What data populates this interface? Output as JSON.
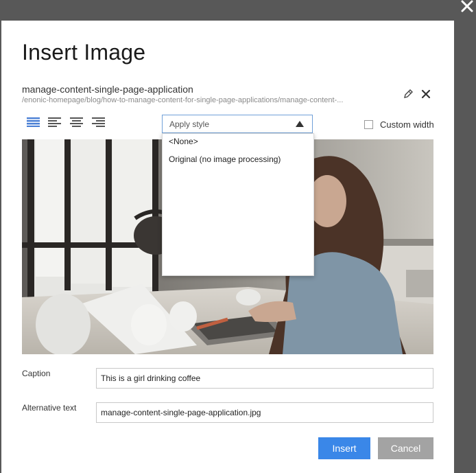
{
  "dialog": {
    "title": "Insert Image",
    "image_name": "manage-content-single-page-application",
    "image_path": "/enonic-homepage/blog/how-to-manage-content-for-single-page-applications/manage-content-..."
  },
  "toolbar": {
    "align_buttons": [
      "align-justify",
      "align-left",
      "align-center",
      "align-right"
    ],
    "active_align": "align-justify",
    "style_placeholder": "Apply style",
    "style_options": [
      "<None>",
      "Original (no image processing)"
    ],
    "custom_width_label": "Custom width",
    "custom_width_checked": false
  },
  "form": {
    "caption_label": "Caption",
    "caption_value": "This is a girl drinking coffee",
    "alt_label": "Alternative text",
    "alt_value": "manage-content-single-page-application.jpg"
  },
  "buttons": {
    "insert_label": "Insert",
    "cancel_label": "Cancel"
  },
  "colors": {
    "accent": "#3a87e8",
    "cancel": "#a3a3a3",
    "active_icon": "#4a7fd4",
    "backdrop": "#585858"
  },
  "icons": {
    "overlay_close": "close-icon",
    "edit": "pencil-icon",
    "remove": "close-icon",
    "dropdown": "triangle-up-icon"
  }
}
